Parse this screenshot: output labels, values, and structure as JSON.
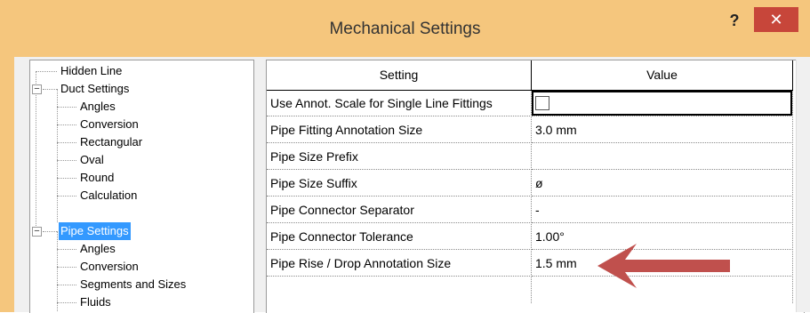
{
  "window": {
    "title": "Mechanical Settings",
    "help_label": "?",
    "close_label": "✕"
  },
  "tree": {
    "items": [
      {
        "label": "Hidden Line"
      },
      {
        "label": "Duct Settings",
        "expander": "−"
      },
      {
        "label": "Angles"
      },
      {
        "label": "Conversion"
      },
      {
        "label": "Rectangular"
      },
      {
        "label": "Oval"
      },
      {
        "label": "Round"
      },
      {
        "label": "Calculation"
      },
      {
        "label": "Pipe Settings",
        "expander": "−",
        "selected": true
      },
      {
        "label": "Angles"
      },
      {
        "label": "Conversion"
      },
      {
        "label": "Segments and Sizes"
      },
      {
        "label": "Fluids"
      }
    ]
  },
  "grid": {
    "header": {
      "setting": "Setting",
      "value": "Value"
    },
    "rows": [
      {
        "setting": "Use Annot. Scale for Single Line Fittings",
        "value": "",
        "checkbox": true
      },
      {
        "setting": "Pipe Fitting Annotation Size",
        "value": "3.0 mm"
      },
      {
        "setting": "Pipe Size Prefix",
        "value": ""
      },
      {
        "setting": "Pipe Size Suffix",
        "value": "ø"
      },
      {
        "setting": "Pipe Connector Separator",
        "value": "-"
      },
      {
        "setting": "Pipe Connector Tolerance",
        "value": "1.00°"
      },
      {
        "setting": "Pipe Rise / Drop Annotation Size",
        "value": "1.5 mm"
      }
    ]
  },
  "annotation": {
    "arrow_color": "#c0504d"
  }
}
